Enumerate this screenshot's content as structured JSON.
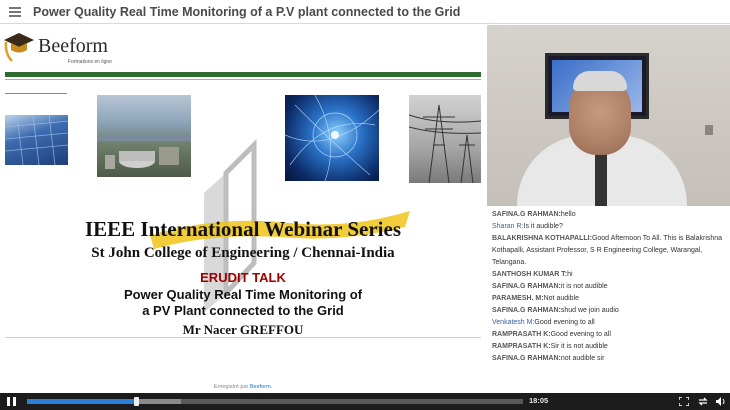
{
  "header": {
    "title": "Power Quality Real Time Monitoring of a P.V plant connected to the Grid",
    "menu_icon": "hamburger-menu-icon"
  },
  "slide": {
    "logo_name": "Beeform",
    "logo_tagline": "Formations en ligne",
    "line1": "IEEE International Webinar Series",
    "line2": "St John College of Engineering  / Chennai-India",
    "talk_type": "ERUDIT TALK",
    "talk_title_1": "Power Quality Real Time Monitoring of",
    "talk_title_2": "a PV Plant connected to the Grid",
    "speaker": "Mr Nacer GREFFOU",
    "recorded_by": "Enregistré par",
    "recorded_brand": "Beeform.",
    "colors": {
      "green_bar": "#2f6b2f",
      "talk_type": "#a30000"
    }
  },
  "chat": {
    "messages": [
      {
        "sender": "SAFINA.G RAHMAN",
        "text": "hello"
      },
      {
        "sender": "Sharan R",
        "text": "Is it audible?",
        "alt": true
      },
      {
        "sender": "BALAKRISHNA KOTHAPALLI",
        "text": "Good Afternoon To All. This is Balakrishna Kothapalli, Assistant Professor, S R Engineering College, Warangal, Telangana."
      },
      {
        "sender": "SANTHOSH KUMAR T",
        "text": "hi"
      },
      {
        "sender": "SAFINA.G RAHMAN",
        "text": "it is not audible"
      },
      {
        "sender": "PARAMESH. M",
        "text": "Not audible"
      },
      {
        "sender": "SAFINA.G RAHMAN",
        "text": "shud we join audio"
      },
      {
        "sender": "Venkatesh M",
        "text": "Good evening to all",
        "alt": true
      },
      {
        "sender": "RAMPRASATH K",
        "text": "Good evening to all"
      },
      {
        "sender": "RAMPRASATH K",
        "text": "Sir it is not audible"
      },
      {
        "sender": "SAFINA.G RAHMAN",
        "text": "not audible sir"
      }
    ]
  },
  "player": {
    "time": "18:05",
    "progress": 0.22,
    "buffered": 0.31,
    "icons": [
      "pause-icon",
      "fullscreen-icon",
      "swap-layout-icon",
      "volume-icon"
    ]
  }
}
